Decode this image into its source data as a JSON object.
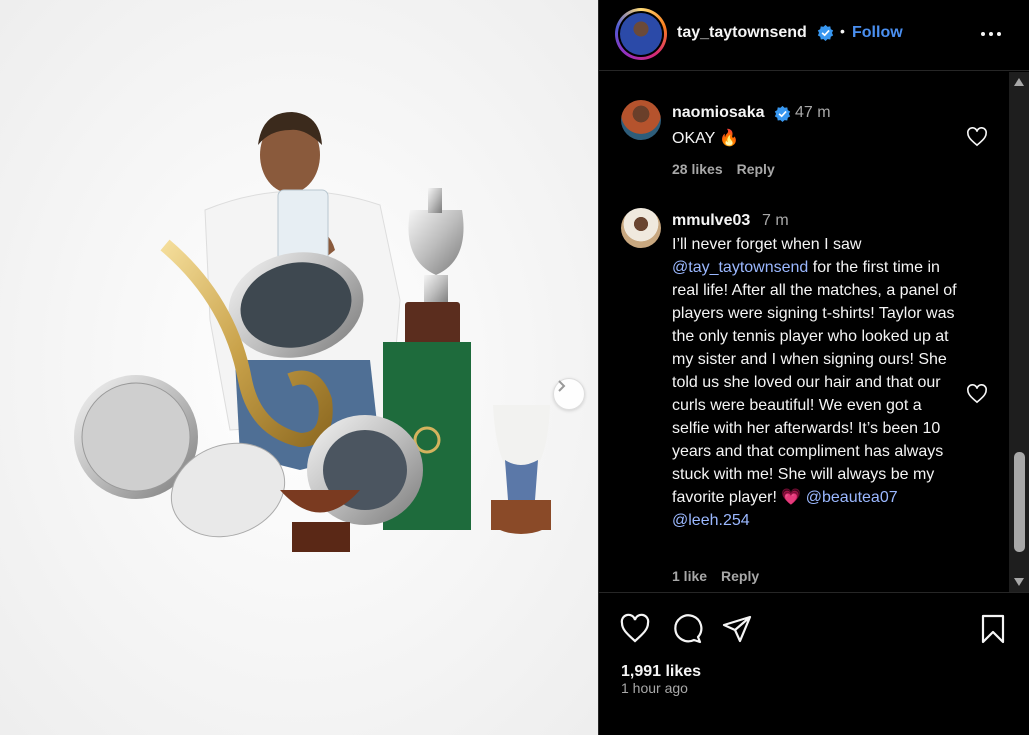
{
  "post": {
    "author": "tay_taytownsend",
    "follow_label": "Follow",
    "separator": "•",
    "likes": "1,991 likes",
    "time_ago": "1 hour ago"
  },
  "comments": [
    {
      "user": "naomiosaka",
      "verified": true,
      "time": "47 m",
      "text": "OKAY 🔥",
      "likes": "28 likes",
      "reply": "Reply"
    },
    {
      "user": "mmulve03",
      "verified": false,
      "time": "7 m",
      "text_before": "I’ll never forget when I saw ",
      "mention1": "@tay_taytownsend",
      "text_after": " for the first time in real life! After all the matches, a panel of players were signing t-shirts! Taylor was the only tennis player who looked up at my sister and I when signing ours! She told us she loved our hair and that our curls were beautiful! We even got a selfie with her afterwards! It’s been 10 years and that compliment has always stuck with me! She will always be my favorite player! 💗 ",
      "mention2": "@beautea07",
      "mention3": "@leeh.254",
      "likes": "1 like",
      "reply": "Reply"
    }
  ],
  "colors": {
    "background": "#000000",
    "link": "#4a8ff0",
    "mention": "#9bb8ff",
    "muted": "#a8a8a8",
    "verified": "#3897f0"
  },
  "icons": [
    "heart-icon",
    "comment-icon",
    "share-icon",
    "bookmark-icon",
    "more-icon",
    "verified-icon",
    "chevron-right-icon"
  ]
}
